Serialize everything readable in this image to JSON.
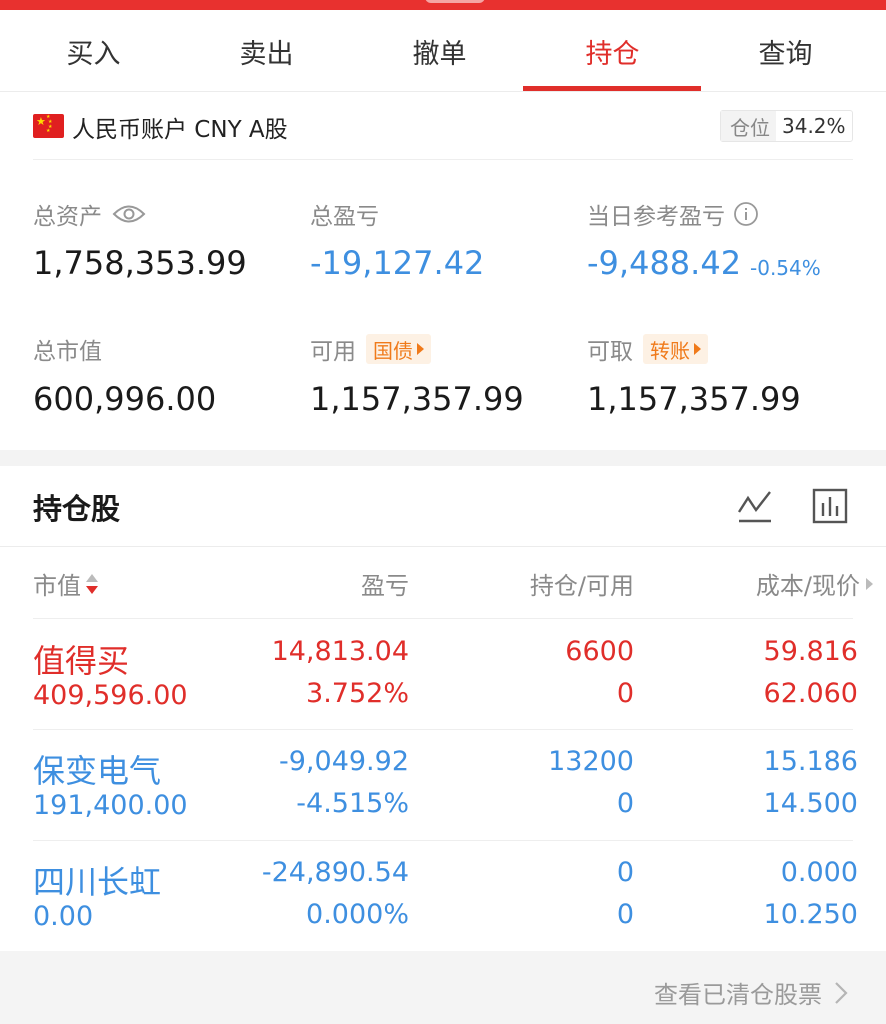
{
  "tabs": [
    {
      "label": "买入"
    },
    {
      "label": "卖出"
    },
    {
      "label": "撤单"
    },
    {
      "label": "持仓"
    },
    {
      "label": "查询"
    }
  ],
  "active_tab": "持仓",
  "account": {
    "name": "人民币账户 CNY A股",
    "position_label": "仓位",
    "position_value": "34.2%"
  },
  "stats": {
    "total_assets_label": "总资产",
    "total_assets": "1,758,353.99",
    "total_pl_label": "总盈亏",
    "total_pl": "-19,127.42",
    "daily_pl_label": "当日参考盈亏",
    "daily_pl": "-9,488.42",
    "daily_pl_pct": "-0.54%",
    "market_value_label": "总市值",
    "market_value": "600,996.00",
    "available_label": "可用",
    "available_chip": "国债",
    "available": "1,157,357.99",
    "withdrawable_label": "可取",
    "withdrawable_chip": "转账",
    "withdrawable": "1,157,357.99"
  },
  "holdings": {
    "title": "持仓股",
    "columns": {
      "market_value": "市值",
      "pl": "盈亏",
      "position": "持仓/可用",
      "cost_price": "成本/现价"
    },
    "rows": [
      {
        "name": "值得买",
        "market_value": "409,596.00",
        "pl": "14,813.04",
        "pl_pct": "3.752%",
        "position": "6600",
        "available": "0",
        "cost": "59.816",
        "price": "62.060",
        "trend": "up"
      },
      {
        "name": "保变电气",
        "market_value": "191,400.00",
        "pl": "-9,049.92",
        "pl_pct": "-4.515%",
        "position": "13200",
        "available": "0",
        "cost": "15.186",
        "price": "14.500",
        "trend": "down"
      },
      {
        "name": "四川长虹",
        "market_value": "0.00",
        "pl": "-24,890.54",
        "pl_pct": "0.000%",
        "position": "0",
        "available": "0",
        "cost": "0.000",
        "price": "10.250",
        "trend": "down"
      }
    ]
  },
  "footer": {
    "link_label": "查看已清仓股票"
  },
  "colors": {
    "up": "#e02e2a",
    "down": "#3e8fe0",
    "accent": "#e02e2a",
    "chip": "#f07a1a"
  },
  "icons": [
    "eye-icon",
    "info-icon",
    "line-chart-icon",
    "bar-chart-icon",
    "sort-icon",
    "chevron-right-icon",
    "china-flag-icon"
  ]
}
